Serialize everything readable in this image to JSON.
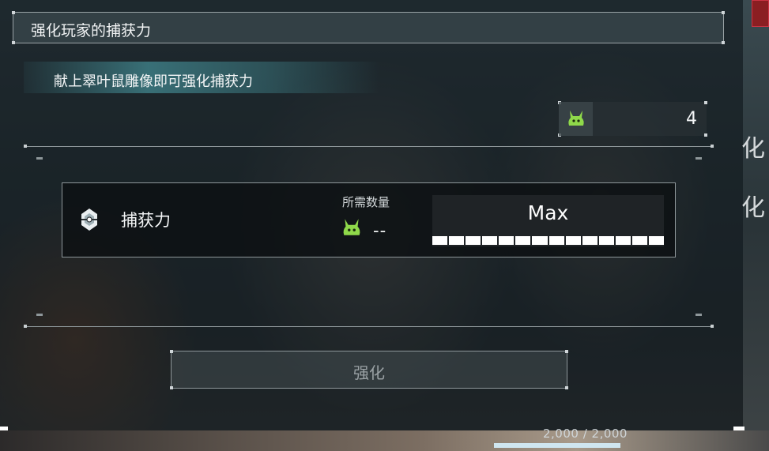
{
  "window": {
    "title": "强化玩家的捕获力",
    "subtitle": "献上翠叶鼠雕像即可强化捕获力"
  },
  "inventory": {
    "icon": "green-rabbit-statue-icon",
    "count": "4"
  },
  "upgrade_row": {
    "icon": "capture-sphere-icon",
    "label": "捕获力",
    "required_label": "所需数量",
    "required_icon": "green-rabbit-statue-icon",
    "required_value": "--",
    "level_text": "Max",
    "level_segments_filled": 14,
    "level_segments_total": 14
  },
  "actions": {
    "upgrade_label": "强化"
  },
  "background": {
    "side_chars": [
      "化",
      "化"
    ],
    "hp_text": "2,000 / 2,000"
  },
  "colors": {
    "accent_green": "#8fd94a",
    "title_bg": "#46545a",
    "teal_highlight": "#5ac8d2"
  }
}
